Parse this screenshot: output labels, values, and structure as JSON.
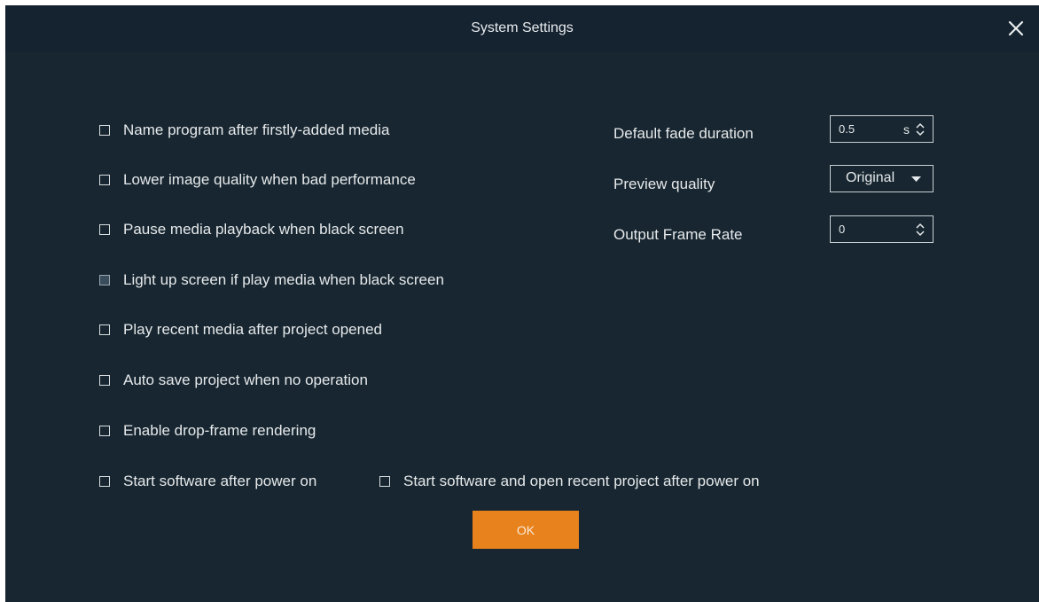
{
  "dialog": {
    "title": "System Settings",
    "close_icon": "close-icon",
    "colors": {
      "background": "#172630",
      "accent": "#e8821c",
      "text": "#e6e9eb"
    }
  },
  "options": [
    {
      "label": "Name program after firstly-added media",
      "checked": false
    },
    {
      "label": "Lower image quality when bad performance",
      "checked": false
    },
    {
      "label": "Pause media playback when black screen",
      "checked": false
    },
    {
      "label": "Light up screen if play media when black screen",
      "checked": false
    },
    {
      "label": "Play recent media after project opened",
      "checked": false
    },
    {
      "label": "Auto save project when no operation",
      "checked": false
    },
    {
      "label": "Enable drop-frame rendering",
      "checked": false
    },
    {
      "label": "Start software after power on",
      "checked": false
    },
    {
      "label": "Start software and open recent project after power on",
      "checked": false
    }
  ],
  "settings": {
    "fade": {
      "label": "Default fade duration",
      "value": "0.5",
      "unit": "s"
    },
    "preview": {
      "label": "Preview quality",
      "value": "Original"
    },
    "frame_rate": {
      "label": "Output Frame Rate",
      "value": "0"
    }
  },
  "ok_button": {
    "label": "OK"
  }
}
